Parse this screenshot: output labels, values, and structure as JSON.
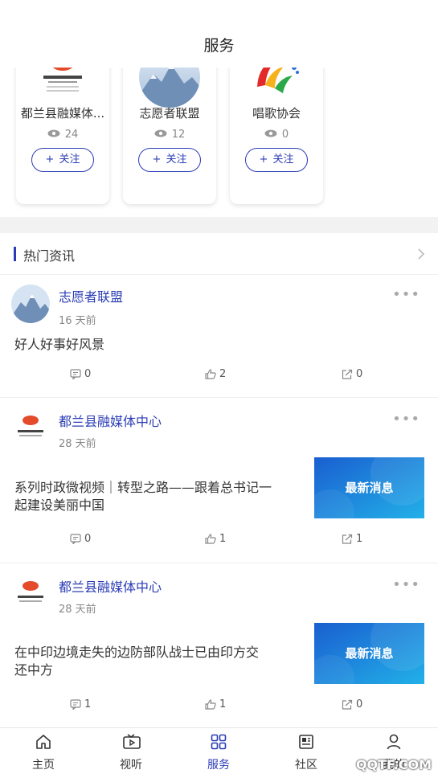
{
  "header": {
    "title": "服务"
  },
  "cards": [
    {
      "name": "都兰县融媒体...",
      "views": "24",
      "follow_label": "关注",
      "logo": "dulan-media-logo"
    },
    {
      "name": "志愿者联盟",
      "views": "12",
      "follow_label": "关注",
      "logo": "mountain-snow-photo"
    },
    {
      "name": "唱歌协会",
      "views": "0",
      "follow_label": "关注",
      "logo": "colorful-swirl-logo"
    }
  ],
  "section": {
    "title": "热门资讯"
  },
  "posts": [
    {
      "author": "志愿者联盟",
      "time": "16 天前",
      "text": "好人好事好风景",
      "comments": "0",
      "likes": "2",
      "shares": "0",
      "thumb": ""
    },
    {
      "author": "都兰县融媒体中心",
      "time": "28 天前",
      "text_line1": "系列时政微视频｜转型之路——跟着总书记一",
      "text_line2": "起建设美丽中国",
      "comments": "0",
      "likes": "1",
      "shares": "1",
      "thumb": "最新消息"
    },
    {
      "author": "都兰县融媒体中心",
      "time": "28 天前",
      "text_line1": "在中印边境走失的边防部队战士已由印方交",
      "text_line2": "还中方",
      "comments": "1",
      "likes": "1",
      "shares": "0",
      "thumb": "最新消息"
    }
  ],
  "tabs": [
    {
      "label": "主页",
      "icon": "home-icon"
    },
    {
      "label": "视听",
      "icon": "video-icon"
    },
    {
      "label": "服务",
      "icon": "grid-icon",
      "active": true
    },
    {
      "label": "社区",
      "icon": "newspaper-icon"
    },
    {
      "label": "我的",
      "icon": "user-icon"
    }
  ],
  "watermark": "QQTF.COM",
  "colors": {
    "accent": "#2a3cb5",
    "thumb_bg": "#1e7fd6"
  }
}
